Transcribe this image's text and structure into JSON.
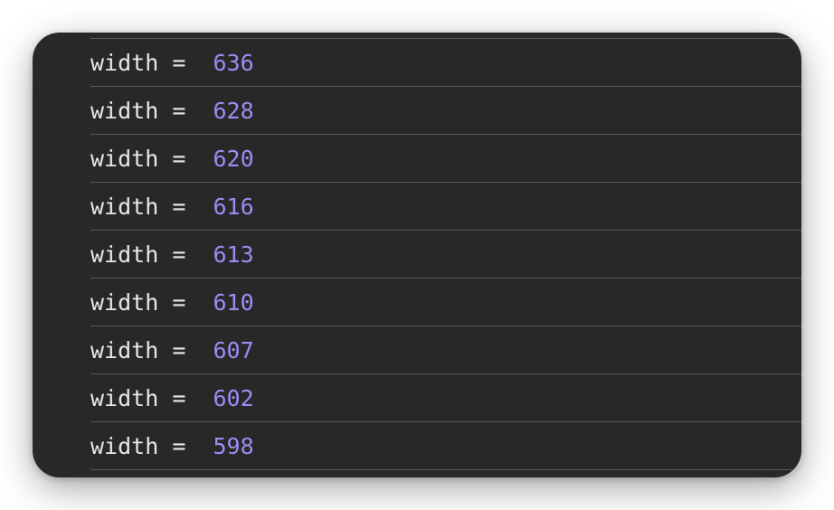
{
  "console": {
    "rows": [
      {
        "key": "width",
        "separator": " =  ",
        "value": "636"
      },
      {
        "key": "width",
        "separator": " =  ",
        "value": "628"
      },
      {
        "key": "width",
        "separator": " =  ",
        "value": "620"
      },
      {
        "key": "width",
        "separator": " =  ",
        "value": "616"
      },
      {
        "key": "width",
        "separator": " =  ",
        "value": "613"
      },
      {
        "key": "width",
        "separator": " =  ",
        "value": "610"
      },
      {
        "key": "width",
        "separator": " =  ",
        "value": "607"
      },
      {
        "key": "width",
        "separator": " =  ",
        "value": "602"
      },
      {
        "key": "width",
        "separator": " =  ",
        "value": "598"
      }
    ]
  },
  "colors": {
    "panel_background": "#282828",
    "text": "#e8e8e8",
    "number": "#9d8cf5",
    "divider": "#5a5a5a"
  }
}
